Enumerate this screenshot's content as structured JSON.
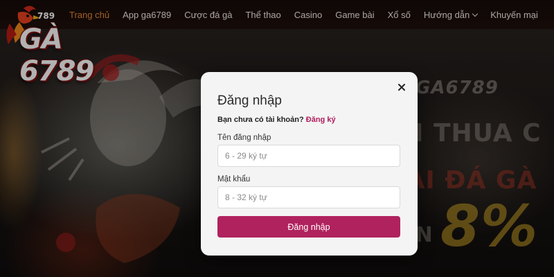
{
  "logo": {
    "small": "789",
    "text": "GÀ 6789"
  },
  "nav": {
    "items": [
      {
        "label": "Trang chủ",
        "active": true
      },
      {
        "label": "App ga6789"
      },
      {
        "label": "Cược đá gà"
      },
      {
        "label": "Thể thao"
      },
      {
        "label": "Casino"
      },
      {
        "label": "Game bài"
      },
      {
        "label": "Xổ số"
      },
      {
        "label": "Hướng dẫn",
        "dropdown": true
      },
      {
        "label": "Khuyến mại"
      }
    ]
  },
  "hero": {
    "brand": "GA6789",
    "line1": "ẾM THUA C",
    "line2": "TẠI ĐÁ GÀ",
    "line3": "ĐẾN",
    "percent": "8%"
  },
  "login": {
    "title": "Đăng nhập",
    "no_account": "Bạn chưa có tài khoản?",
    "register": "Đăng ký",
    "username_label": "Tên đăng nhập",
    "username_placeholder": "6 - 29 ký tự",
    "username_value": "",
    "password_label": "Mật khẩu",
    "password_placeholder": "8 - 32 ký tự",
    "password_value": "",
    "submit": "Đăng nhập"
  },
  "icons": {
    "close": "close-icon",
    "chevron": "chevron-down-icon"
  },
  "colors": {
    "accent": "#b0225e",
    "nav_active": "#e8893a",
    "modal_bg": "#f4f4f4"
  }
}
